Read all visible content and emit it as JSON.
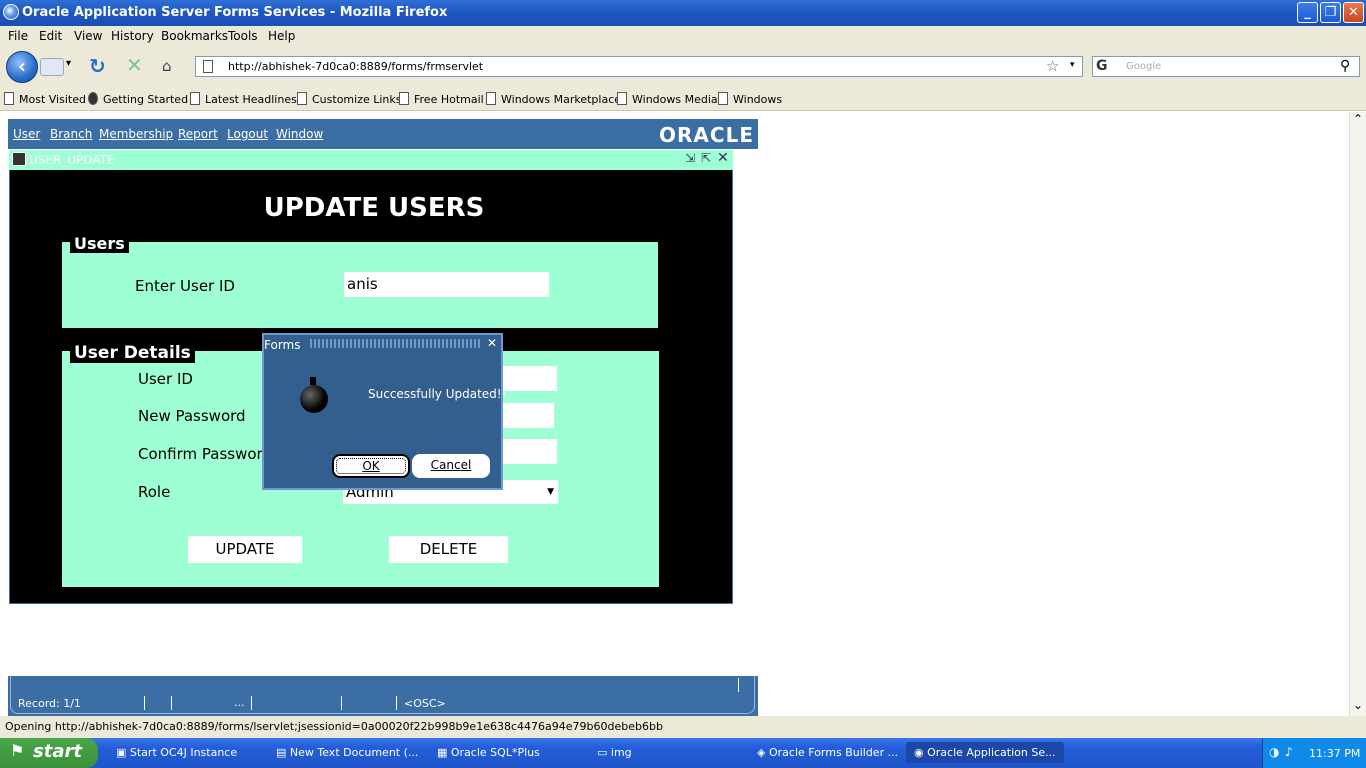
{
  "window": {
    "title": "Oracle Application Server Forms Services - Mozilla Firefox"
  },
  "menu": [
    "File",
    "Edit",
    "View",
    "History",
    "Bookmarks",
    "Tools",
    "Help"
  ],
  "nav": {
    "url": "http://abhishek-7d0ca0:8889/forms/frmservlet",
    "search_placeholder": "Google"
  },
  "bookmarks": [
    "Most Visited",
    "Getting Started",
    "Latest Headlines",
    "Customize Links",
    "Free Hotmail",
    "Windows Marketplace",
    "Windows Media",
    "Windows"
  ],
  "oracle": {
    "menu": [
      "User",
      "Branch",
      "Membership",
      "Report",
      "Logout",
      "Window"
    ],
    "logo": "ORACLE",
    "window_title": "USER_UPDATE",
    "heading": "UPDATE USERS",
    "users_section": {
      "label": "Users",
      "field_label": "Enter User ID",
      "field_value": "anis"
    },
    "details_section": {
      "label": "User Details",
      "user_id_label": "User ID",
      "new_password_label": "New Password",
      "confirm_password_label": "Confirm Password",
      "role_label": "Role",
      "role_value": "Admin"
    },
    "buttons": {
      "update": "UPDATE",
      "delete": "DELETE"
    },
    "record": "Record: 1/1",
    "status_osc": "<OSC>",
    "status_dots": "..."
  },
  "dialog": {
    "title": "Forms",
    "message": "Successfully Updated!!",
    "ok": "OK",
    "cancel": "Cancel"
  },
  "statusbar": {
    "text": "Opening http://abhishek-7d0ca0:8889/forms/lservlet;jsessionid=0a00020f22b998b9e1e638c4476a94e79b60debeb6bb"
  },
  "taskbar": {
    "start": "start",
    "tasks": [
      "Start OC4J Instance",
      "New Text Document (...",
      "Oracle SQL*Plus",
      "img",
      "Oracle Forms Builder ...",
      "Oracle Application Se..."
    ],
    "clock": "11:37 PM"
  }
}
